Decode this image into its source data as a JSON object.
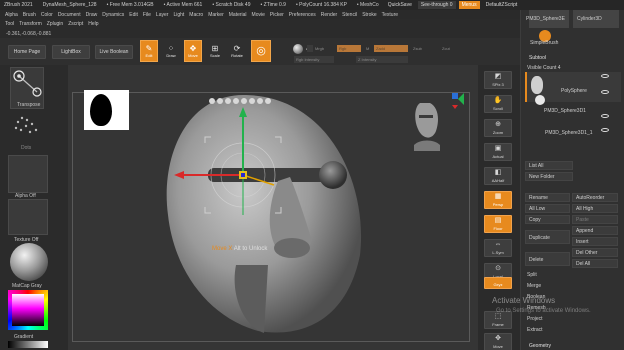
{
  "titlebar": {
    "app": "ZBrush 2021",
    "doc": "DynaMesh_Sphere_128",
    "free_mem": "• Free Mem 3.014GB",
    "active_mem": "• Active Mem 661",
    "scratch": "• Scratch Disk 49",
    "ztime": "• ZTime 0.9",
    "poly": "• PolyCount 16.384 KP",
    "mesh": "• MeshCo",
    "quicksave": "QuickSave",
    "seethrough": "See-through 0",
    "menus": "Menus",
    "default_script": "DefaultZScript"
  },
  "menu": [
    "Alpha",
    "Brush",
    "Color",
    "Document",
    "Draw",
    "Dynamics",
    "Edit",
    "File",
    "Layer",
    "Light",
    "Macro",
    "Marker",
    "Material",
    "Movie",
    "Picker",
    "Preferences",
    "Render",
    "Stencil",
    "Stroke",
    "Texture"
  ],
  "menu2": [
    "Tool",
    "Transform",
    "Zplugin",
    "Zscript",
    "Help"
  ],
  "coords": "-0.361,-0.068,-0.881",
  "toolbar": {
    "home": "Home Page",
    "lightbox": "LightBox",
    "live_boolean": "Live Boolean",
    "edit": "Edit",
    "draw": "Draw",
    "move": "Move",
    "scale": "Scale",
    "rotate": "Rotate",
    "a_label": "A",
    "mrgb": "Mrgb",
    "rgb": "Rgb",
    "m": "M",
    "zadd": "Zadd",
    "zsub": "Zsub",
    "zcut": "Zcut",
    "rgb_intensity": "Rgb Intensity",
    "z_intensity": "Z Intensity"
  },
  "left": {
    "transpose": "Transpose",
    "dots": "Dots",
    "alpha_off": "Alpha Off",
    "texture_off": "Texture Off",
    "matcap": "MatCap Gray",
    "gradient": "Gradient"
  },
  "viewport": {
    "hint_key": "Move X",
    "hint_rest": "Alt to Unlock"
  },
  "shelf": [
    {
      "label": "SPix 3",
      "active": false
    },
    {
      "label": "Scroll",
      "active": false
    },
    {
      "label": "Zoom",
      "active": false
    },
    {
      "label": "Actual",
      "active": false
    },
    {
      "label": "AAHalf",
      "active": false
    },
    {
      "label": "Persp",
      "active": true
    },
    {
      "label": "Floor",
      "active": true
    },
    {
      "label": "L.Sym",
      "active": false
    },
    {
      "label": "Local",
      "active": false
    },
    {
      "label": "Gxyz",
      "active": true
    },
    {
      "label": "Frame",
      "active": false
    },
    {
      "label": "Move",
      "active": false
    }
  ],
  "tray": {
    "thumb1": "PM3D_Sphere3E",
    "thumb2": "Cylinder3D",
    "simplebrush": "SimpleBrush",
    "subtool": "Subtool",
    "visible_count": "Visible Count 4",
    "polysphere": "PolySphere",
    "sphere3d1": "PM3D_Sphere3D1",
    "sphere3d1_1": "PM3D_Sphere3D1_1",
    "list_all": "List All",
    "new_folder": "New Folder",
    "rename": "Rename",
    "autoreorder": "AutoReorder",
    "all_low": "All Low",
    "all_high": "All High",
    "copy": "Copy",
    "paste": "Paste",
    "duplicate": "Duplicate",
    "append": "Append",
    "insert": "Insert",
    "delete": "Delete",
    "del_other": "Del Other",
    "del_all": "Del All",
    "split": "Split",
    "merge": "Merge",
    "boolean": "Boolean",
    "remesh": "Remesh",
    "project": "Project",
    "extract": "Extract",
    "geometry": "Geometry"
  },
  "watermark": {
    "line1": "Activate Windows",
    "line2": "Go to Settings to activate Windows."
  },
  "colors": {
    "accent": "#e78a1e",
    "panel": "#2b2b2b",
    "viewport": "#353535"
  }
}
